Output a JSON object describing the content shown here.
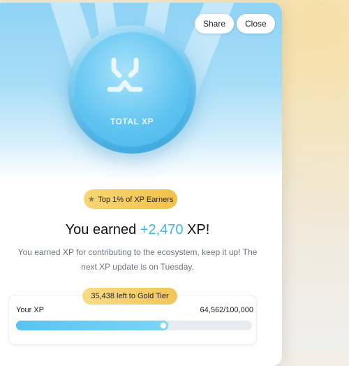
{
  "header": {
    "share_label": "Share",
    "close_label": "Close"
  },
  "coin": {
    "label": "TOTAL XP",
    "icon": "xp-logo-icon"
  },
  "badge": {
    "icon": "star-icon",
    "label": "Top 1% of XP Earners"
  },
  "headline": {
    "prefix": "You earned ",
    "amount": "+2,470",
    "suffix": " XP!"
  },
  "description": {
    "line1": "You earned XP for contributing to the ecosystem, keep it up! The",
    "line2": "next XP update is on Tuesday."
  },
  "progress": {
    "tier_label": "35,438 left to Gold Tier",
    "your_xp_label": "Your XP",
    "count_label": "64,562/100,000",
    "current": 64562,
    "target": 100000
  },
  "colors": {
    "accent": "#3bb8ee",
    "gold": "#f0c24a",
    "hero_top": "#8fd3f5"
  }
}
